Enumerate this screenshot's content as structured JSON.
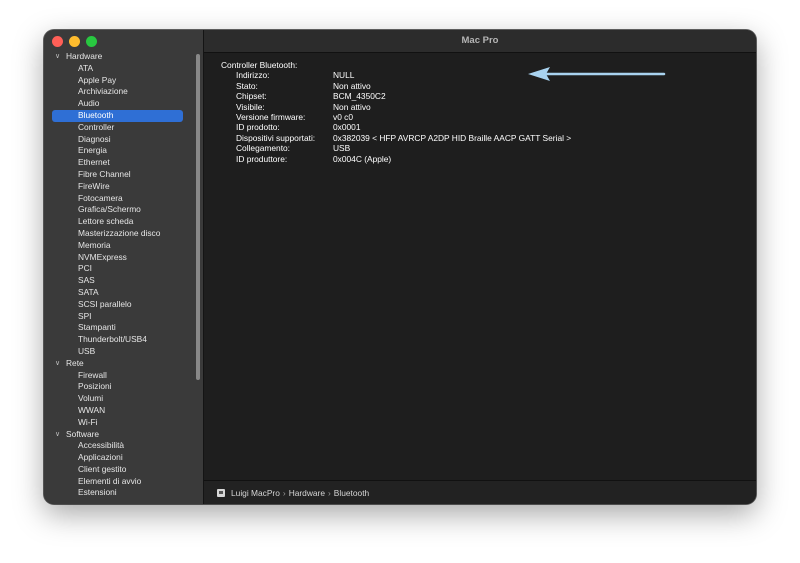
{
  "window": {
    "title": "Mac Pro"
  },
  "sidebar": {
    "groups": [
      {
        "label": "Hardware",
        "items": [
          "ATA",
          "Apple Pay",
          "Archiviazione",
          "Audio",
          "Bluetooth",
          "Controller",
          "Diagnosi",
          "Energia",
          "Ethernet",
          "Fibre Channel",
          "FireWire",
          "Fotocamera",
          "Grafica/Schermo",
          "Lettore scheda",
          "Masterizzazione disco",
          "Memoria",
          "NVMExpress",
          "PCI",
          "SAS",
          "SATA",
          "SCSI parallelo",
          "SPI",
          "Stampanti",
          "Thunderbolt/USB4",
          "USB"
        ]
      },
      {
        "label": "Rete",
        "items": [
          "Firewall",
          "Posizioni",
          "Volumi",
          "WWAN",
          "Wi-Fi"
        ]
      },
      {
        "label": "Software",
        "items": [
          "Accessibilità",
          "Applicazioni",
          "Client gestito",
          "Elementi di avvio",
          "Estensioni"
        ]
      }
    ],
    "selected": "Bluetooth",
    "chevron_icon": "chevron-down-icon"
  },
  "detail": {
    "section_title": "Controller Bluetooth:",
    "properties": [
      {
        "key": "Indirizzo:",
        "value": "NULL"
      },
      {
        "key": "Stato:",
        "value": "Non attivo"
      },
      {
        "key": "Chipset:",
        "value": "BCM_4350C2"
      },
      {
        "key": "Visibile:",
        "value": "Non attivo"
      },
      {
        "key": "Versione firmware:",
        "value": "v0 c0"
      },
      {
        "key": "ID prodotto:",
        "value": "0x0001"
      },
      {
        "key": "Dispositivi supportati:",
        "value": "0x382039 < HFP AVRCP A2DP HID Braille AACP GATT Serial >"
      },
      {
        "key": "Collegamento:",
        "value": "USB"
      },
      {
        "key": "ID produttore:",
        "value": "0x004C (Apple)"
      }
    ],
    "annotation_arrow_color": "#a9d3f0"
  },
  "pathbar": {
    "icon": "computer-icon",
    "crumbs": [
      "Luigi MacPro",
      "Hardware",
      "Bluetooth"
    ],
    "separator": "›"
  },
  "colors": {
    "selection": "#2f6fd5",
    "sidebar_bg": "#3a3a3a",
    "content_bg": "#1e1e1e"
  }
}
